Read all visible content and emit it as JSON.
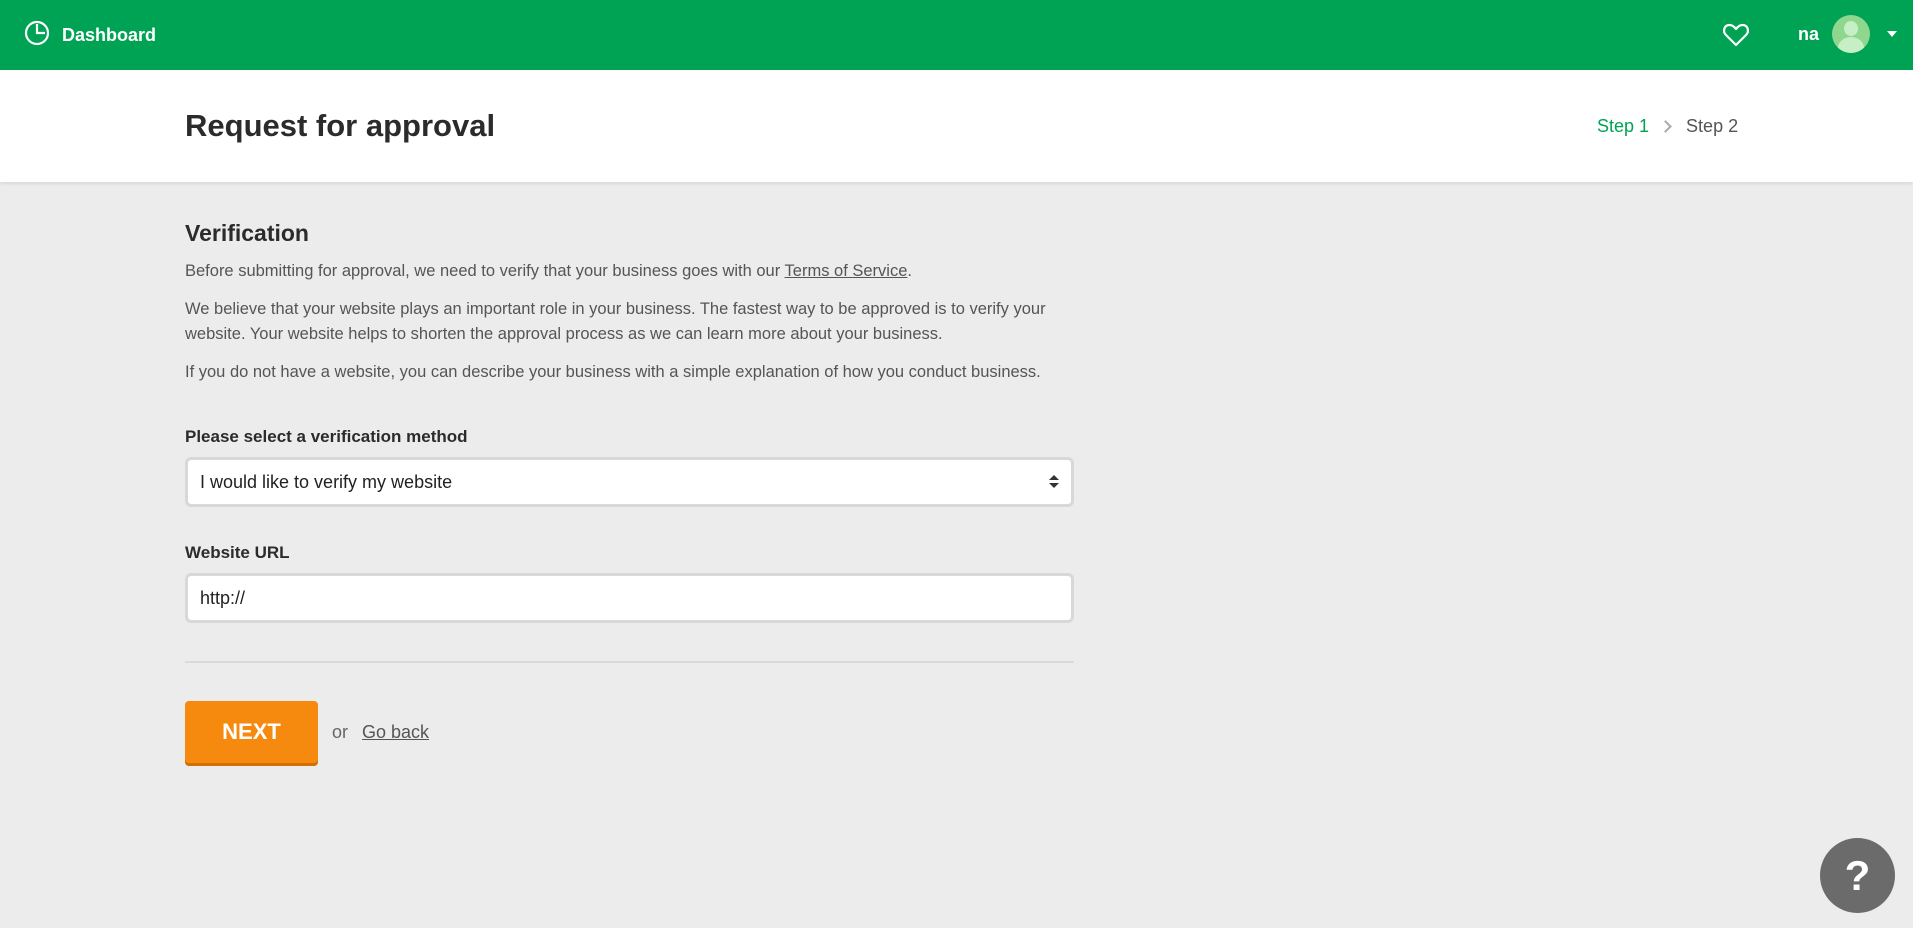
{
  "topbar": {
    "dashboard_label": "Dashboard",
    "user_name": "na",
    "brand_color": "#00a353"
  },
  "header": {
    "title": "Request for approval",
    "step1": "Step 1",
    "step2": "Step 2"
  },
  "verification": {
    "title": "Verification",
    "para1_prefix": "Before submitting for approval, we need to verify that your business goes with our ",
    "tos_link": "Terms of Service",
    "para1_suffix": ".",
    "para2": "We believe that your website plays an important role in your business. The fastest way to be approved is to verify your website. Your website helps to shorten the approval process as we can learn more about your business.",
    "para3": "If you do not have a website, you can describe your business with a simple explanation of how you conduct business.",
    "method_label": "Please select a verification method",
    "method_value": "I would like to verify my website",
    "url_label": "Website URL",
    "url_value": "http://"
  },
  "actions": {
    "next_label": "NEXT",
    "or_text": "or",
    "go_back_label": "Go back",
    "next_color": "#f58a0e"
  },
  "help": {
    "label": "?"
  }
}
